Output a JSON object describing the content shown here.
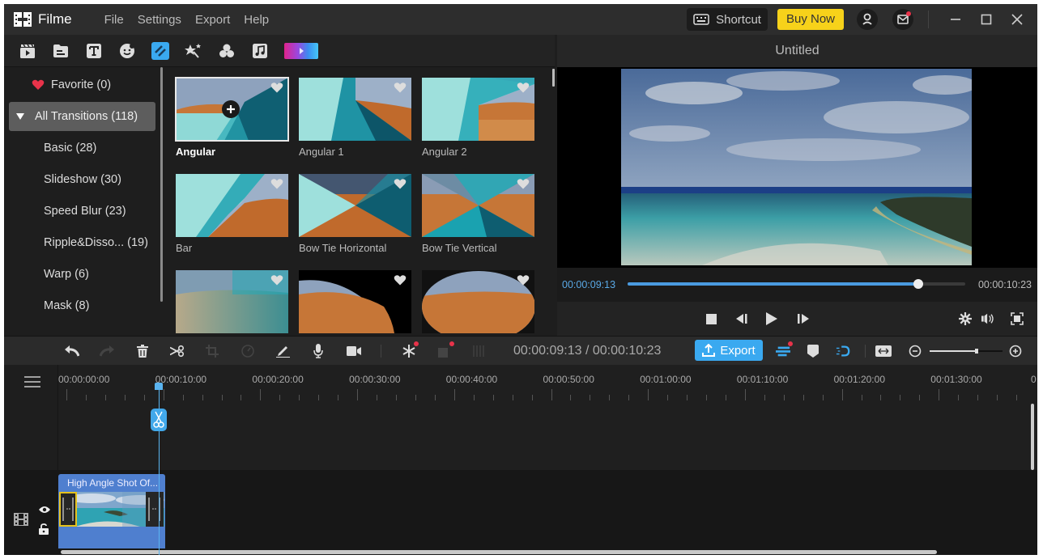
{
  "app": {
    "name": "Filme",
    "menu": [
      "File",
      "Settings",
      "Export",
      "Help"
    ],
    "shortcut_label": "Shortcut",
    "buy_label": "Buy Now"
  },
  "categories": {
    "items": [
      {
        "name": "media",
        "icon": "clapperboard-icon"
      },
      {
        "name": "folder",
        "icon": "folder-icon"
      },
      {
        "name": "text",
        "icon": "text-icon"
      },
      {
        "name": "sticker",
        "icon": "sticker-icon"
      },
      {
        "name": "transitions",
        "icon": "transition-icon",
        "active": true
      },
      {
        "name": "effects",
        "icon": "magic-wand-icon"
      },
      {
        "name": "filters",
        "icon": "filter-circles-icon"
      },
      {
        "name": "music",
        "icon": "music-icon"
      },
      {
        "name": "color",
        "icon": "gradient-icon"
      }
    ]
  },
  "sidebar": {
    "favorite": "Favorite (0)",
    "group": "All Transitions (118)",
    "items": [
      "Basic (28)",
      "Slideshow (30)",
      "Speed Blur (23)",
      "Ripple&Disso... (19)",
      "Warp (6)",
      "Mask (8)"
    ]
  },
  "transitions": [
    {
      "label": "Angular",
      "selected": true
    },
    {
      "label": "Angular 1"
    },
    {
      "label": "Angular 2"
    },
    {
      "label": "Bar"
    },
    {
      "label": "Bow Tie Horizontal"
    },
    {
      "label": "Bow Tie Vertical"
    },
    {
      "label": ""
    },
    {
      "label": ""
    },
    {
      "label": ""
    }
  ],
  "preview": {
    "title": "Untitled",
    "current_time": "00:00:09:13",
    "total_time": "00:00:10:23",
    "progress": 0.86
  },
  "timeline": {
    "time_display": "00:00:09:13 / 00:00:10:23",
    "export_label": "Export",
    "zoom_level": 0.64,
    "ruler_labels": [
      "00:00:00:00",
      "00:00:10:00",
      "00:00:20:00",
      "00:00:30:00",
      "00:00:40:00",
      "00:00:50:00",
      "00:01:00:00",
      "00:01:10:00",
      "00:01:20:00",
      "00:01:30:00",
      "0"
    ],
    "playhead_seconds": 9.5,
    "clip_title": "High Angle Shot Of..."
  },
  "colors": {
    "accent": "#3aa9f0",
    "buy": "#f7d21a",
    "clip": "#4f7fcf",
    "notify": "#e8334a"
  }
}
